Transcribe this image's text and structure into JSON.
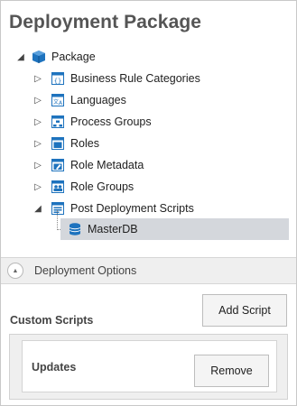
{
  "panel": {
    "title": "Deployment Package"
  },
  "tree": {
    "root": {
      "label": "Package",
      "icon": "package-icon"
    },
    "children": [
      {
        "label": "Business Rule Categories",
        "icon": "business-rule-categories-icon"
      },
      {
        "label": "Languages",
        "icon": "languages-icon"
      },
      {
        "label": "Process Groups",
        "icon": "process-groups-icon"
      },
      {
        "label": "Roles",
        "icon": "roles-icon"
      },
      {
        "label": "Role Metadata",
        "icon": "role-metadata-icon"
      },
      {
        "label": "Role Groups",
        "icon": "role-groups-icon"
      },
      {
        "label": "Post Deployment Scripts",
        "icon": "post-deployment-scripts-icon"
      }
    ],
    "scripts": [
      {
        "label": "MasterDB",
        "icon": "database-icon",
        "selected": true
      }
    ]
  },
  "deployment_options": {
    "label": "Deployment Options"
  },
  "custom_scripts": {
    "label": "Custom Scripts",
    "add_label": "Add Script",
    "items": [
      {
        "name": "Updates",
        "remove_label": "Remove"
      }
    ]
  },
  "colors": {
    "icon_blue": "#1e73be",
    "selection": "#d4d7dc",
    "section_bg": "#efefef"
  }
}
